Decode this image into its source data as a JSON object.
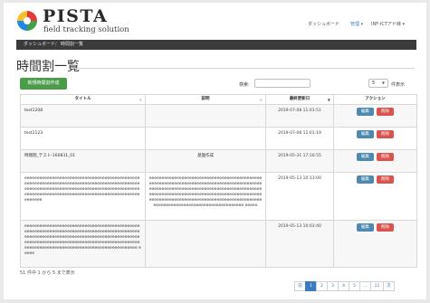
{
  "header": {
    "brand": "PISTA",
    "tagline": "field tracking solution",
    "nav": {
      "dashboard": "ダッシュボード",
      "manage": "管理 ▾",
      "user": "INF-ICTアド様 ▾"
    }
  },
  "breadcrumb": {
    "home": "ダッシュボード",
    "separator": "/",
    "current": "時間割一覧"
  },
  "page": {
    "title": "時間割一覧"
  },
  "toolbar": {
    "new_label": "新規時間割作成",
    "search_label": "検索:",
    "search_value": "",
    "per_page_value": "5",
    "per_page_label": "件表示"
  },
  "table": {
    "headers": {
      "title": "タイトル",
      "description": "説明",
      "updated": "最終更新日",
      "action": "アクション"
    },
    "rows": [
      {
        "title": "test1208",
        "description": "",
        "updated": "2019-07-08 11:01:51",
        "edit": "編集",
        "delete": "削除"
      },
      {
        "title": "test1123",
        "description": "",
        "updated": "2019-07-08 11:01:19",
        "edit": "編集",
        "delete": "削除"
      },
      {
        "title": "時間割_テスト-160831_01",
        "description": "基盤作成",
        "updated": "2019-05-31 17:16:55",
        "edit": "編集",
        "delete": "削除"
      },
      {
        "title": "eeeeeeeeeeeeeeeeeeeeeeeeeeeeeeeeeeeeeeeeeeeeeeeeeeeeeeeeeeeeeeeeeeeeeeeeeeeeeeeeeeeeeeeeeeeeeeeeeeeeeeeeeeeeeeeeeeeeeeeeeeeeeeeeeeeeeeeeeeeeeeeeeeeeeeeeeeeeeeeeeeeeeeeeeeeeeeeeeeeeeeeeeeeeeee",
        "description": "eeeeeeeeeeeeeeeeeeeeeeeeeeeeeeeeeeeeeeeeeeeeeeeeeeeeeeeeeeeeeeeeeeeeeeeeeeeeeeeeeeeeeeeeeeeeeeeeeeeeeeeeeeeeeeeeeeeeeeeeeeeeeeeeeeeeeeeeeeeeeeeeeeeeeeeeeeeeeeeeeeeeeeeeeeeeeeeeeeeeeeeeeeeeeeeeeeeeeeeeeeeeeeeeeeeeeeeeeeeeeeeeeeeeeeeeeeeeeeeeeeeeeeeeeeeeeeeeeeeee eeeee",
        "updated": "2019-05-13 10:13:00",
        "edit": "編集",
        "delete": "削除"
      },
      {
        "title": "eeeeeeeeeeeeeeeeeeeeeeeeeeeeeeeeeeeeeeeeeeeeeeeeeeeeeeeeeeeeeeeeeeeeeeeeeeeeeeeeeeeeeeeeeeeeeeeeeeeeeeeeeeeeeeeeeeeeeeeeeeeeeeeeeeeeeeeeeeeeeeeeeeeeeeeeeeeeeeeeeeeeeeeeeeeeeeeeeeeeeeeeeeeeeeeeeeeeeeeeeeeeeeeeeeeeeeeeeeeeeeeeeeeee eeeee",
        "description": "",
        "updated": "2019-05-13 10:03:40",
        "edit": "編集",
        "delete": "削除"
      }
    ]
  },
  "footer": {
    "count_text": "51 件中 1 から 5 まで表示"
  },
  "pagination": {
    "prev": "前",
    "pages": [
      "1",
      "2",
      "3",
      "4",
      "5",
      "…",
      "11"
    ],
    "next": "次"
  },
  "colors": {
    "primary": "#3b7bbf",
    "success": "#4a9b4a",
    "danger": "#d9534f",
    "info": "#4e8ab0",
    "crumb_bg": "#3b3b3b"
  }
}
